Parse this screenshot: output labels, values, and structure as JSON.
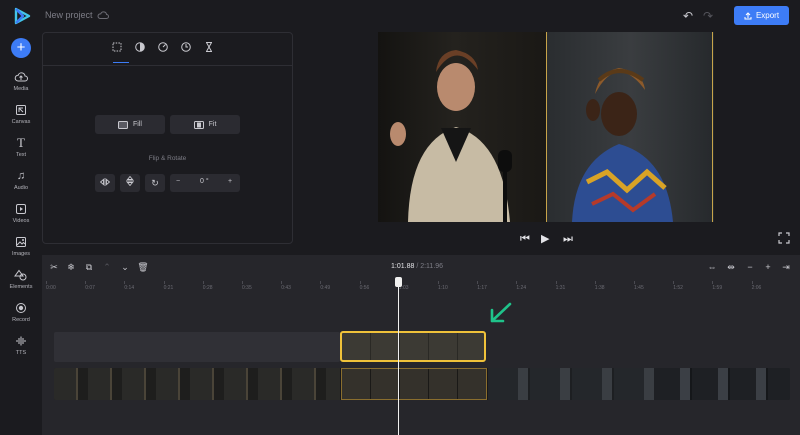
{
  "header": {
    "project_name": "New project",
    "export_label": "Export"
  },
  "sidebar": {
    "items": [
      {
        "label": "Media",
        "icon": "cloud-upload-icon"
      },
      {
        "label": "Canvas",
        "icon": "canvas-icon"
      },
      {
        "label": "Text",
        "icon": "text-icon"
      },
      {
        "label": "Audio",
        "icon": "music-icon"
      },
      {
        "label": "Videos",
        "icon": "video-icon"
      },
      {
        "label": "Images",
        "icon": "image-icon"
      },
      {
        "label": "Elements",
        "icon": "shapes-icon"
      },
      {
        "label": "Record",
        "icon": "record-icon"
      },
      {
        "label": "TTS",
        "icon": "waveform-icon"
      }
    ]
  },
  "panel": {
    "fill_label": "Fill",
    "fit_label": "Fit",
    "flip_rotate_title": "Flip & Rotate",
    "rotation_value": "0 °",
    "minus": "−",
    "plus": "+"
  },
  "timeline": {
    "current_time": "1:01.88",
    "separator": "/",
    "total_time": "2:11.96",
    "ruler_ticks": [
      "0:00",
      "0:07",
      "0:14",
      "0:21",
      "0:28",
      "0:35",
      "0:43",
      "0:49",
      "0:56",
      "1:03",
      "1:10",
      "1:17",
      "1:24",
      "1:31",
      "1:38",
      "1:45",
      "1:52",
      "1:59",
      "2:06"
    ]
  },
  "colors": {
    "accent": "#3d7cf6",
    "selection": "#f0c23a",
    "arrow": "#1fc28a"
  }
}
